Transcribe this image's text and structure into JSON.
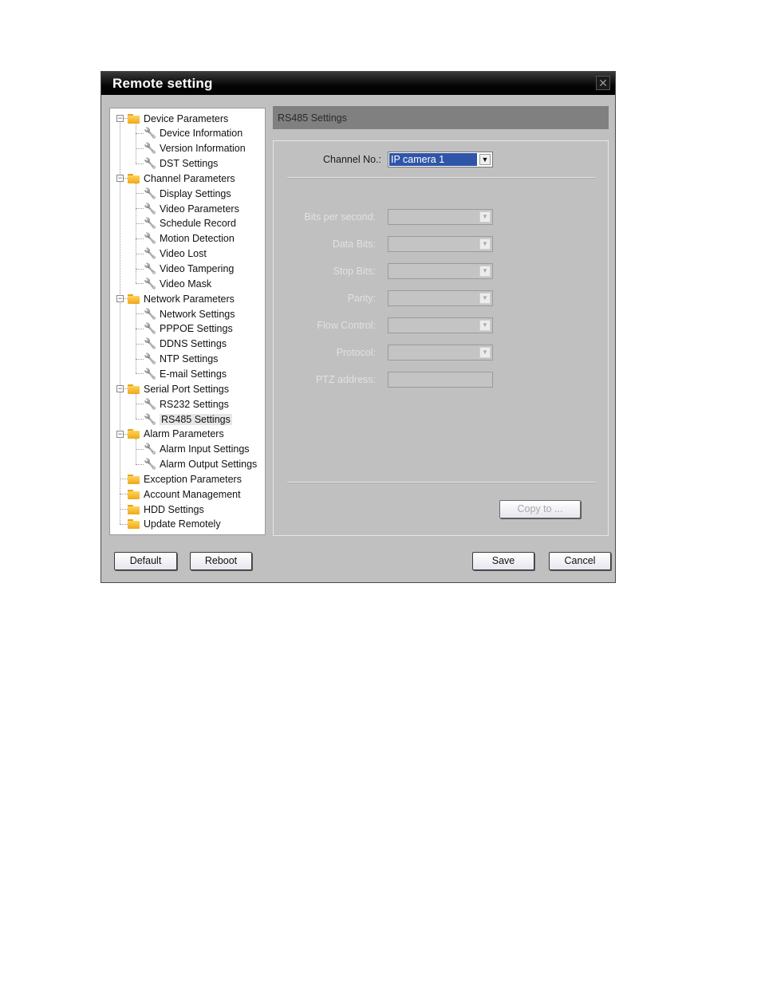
{
  "window": {
    "title": "Remote setting",
    "close_icon": "close-icon"
  },
  "tree": {
    "groups": [
      {
        "label": "Device Parameters",
        "expanded": true,
        "children": [
          "Device Information",
          "Version Information",
          "DST Settings"
        ]
      },
      {
        "label": "Channel Parameters",
        "expanded": true,
        "children": [
          "Display Settings",
          "Video Parameters",
          "Schedule Record",
          "Motion Detection",
          "Video Lost",
          "Video Tampering",
          "Video Mask"
        ]
      },
      {
        "label": "Network Parameters",
        "expanded": true,
        "children": [
          "Network Settings",
          "PPPOE Settings",
          "DDNS Settings",
          "NTP Settings",
          "E-mail Settings"
        ]
      },
      {
        "label": "Serial Port Settings",
        "expanded": true,
        "children": [
          "RS232 Settings",
          "RS485 Settings"
        ]
      },
      {
        "label": "Alarm Parameters",
        "expanded": true,
        "children": [
          "Alarm Input Settings",
          "Alarm Output Settings"
        ]
      },
      {
        "label": "Exception Parameters",
        "expanded": false,
        "children": []
      },
      {
        "label": "Account Management",
        "expanded": false,
        "children": []
      },
      {
        "label": "HDD Settings",
        "expanded": false,
        "children": []
      },
      {
        "label": "Update Remotely",
        "expanded": false,
        "children": []
      }
    ],
    "selected": "RS485 Settings"
  },
  "panel": {
    "header": "RS485 Settings",
    "channel": {
      "label": "Channel No.:",
      "value": "IP camera 1"
    },
    "fields": [
      {
        "label": "Bits per second:",
        "type": "combo",
        "value": ""
      },
      {
        "label": "Data Bits:",
        "type": "combo",
        "value": ""
      },
      {
        "label": "Stop Bits:",
        "type": "combo",
        "value": ""
      },
      {
        "label": "Parity:",
        "type": "combo",
        "value": ""
      },
      {
        "label": "Flow Control:",
        "type": "combo",
        "value": ""
      },
      {
        "label": "Protocol:",
        "type": "combo",
        "value": ""
      },
      {
        "label": "PTZ address:",
        "type": "text",
        "value": ""
      }
    ],
    "copy_button": "Copy to ..."
  },
  "footer": {
    "default_label": "Default",
    "reboot_label": "Reboot",
    "save_label": "Save",
    "cancel_label": "Cancel"
  },
  "colors": {
    "titlebar": "#000000",
    "dialog_bg": "#c0c0c0",
    "header_bar": "#808080",
    "selection": "#2f55a8",
    "folder": "#f0a818"
  }
}
